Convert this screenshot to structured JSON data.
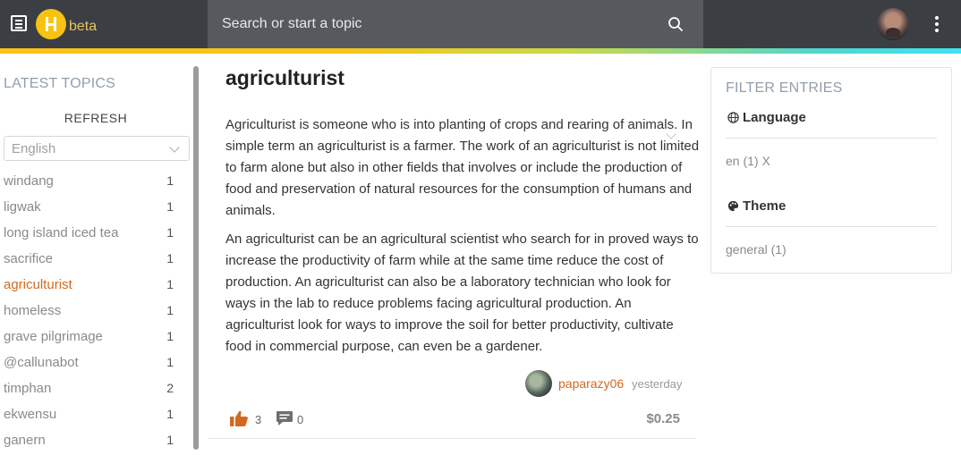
{
  "header": {
    "beta_label": "beta",
    "search_placeholder": "Search or start a topic"
  },
  "sidebar": {
    "heading": "LATEST TOPICS",
    "refresh_label": "REFRESH",
    "language_selected": "English",
    "topics": [
      {
        "name": "windang",
        "count": "1"
      },
      {
        "name": "ligwak",
        "count": "1"
      },
      {
        "name": "long island iced tea",
        "count": "1"
      },
      {
        "name": "sacrifice",
        "count": "1"
      },
      {
        "name": "agriculturist",
        "count": "1"
      },
      {
        "name": "homeless",
        "count": "1"
      },
      {
        "name": "grave pilgrimage",
        "count": "1"
      },
      {
        "name": "@callunabot",
        "count": "1"
      },
      {
        "name": "timphan",
        "count": "2"
      },
      {
        "name": "ekwensu",
        "count": "1"
      },
      {
        "name": "ganern",
        "count": "1"
      }
    ]
  },
  "article": {
    "title": "agriculturist",
    "paragraphs": [
      "Agriculturist is someone who is into planting of crops and rearing of animals. In simple term an agriculturist is a farmer. The work of an agriculturist is not limited to farm alone but also in other fields that involves or include the production of food and preservation of natural resources for the consumption of humans and animals.",
      "An agriculturist can be an agricultural scientist who search for in proved ways to increase the productivity of farm while at the same time reduce the cost of production. An agriculturist can also be a laboratory technician who look for ways in the lab to reduce problems facing agricultural production. An agriculturist look for ways to improve the soil for better productivity, cultivate food in commercial purpose, can even be a gardener."
    ],
    "author": "paparazy06",
    "time": "yesterday",
    "likes": "3",
    "comments": "0",
    "payout": "$0.25"
  },
  "filters": {
    "heading": "FILTER ENTRIES",
    "language_label": "Language",
    "language_value": "en (1) X",
    "theme_label": "Theme",
    "theme_value": "general (1)"
  },
  "colors": {
    "topbar": "#3b3f44",
    "accent_orange": "#d2691e",
    "logo_yellow": "#f6c313",
    "stripe_start": "#f9c316",
    "stripe_end": "#3fe3ef"
  },
  "icons": [
    "list-menu-icon",
    "hive-logo-icon",
    "search-icon",
    "kebab-menu-icon",
    "chevron-down-icon",
    "thumbs-up-icon",
    "comment-icon",
    "globe-icon",
    "palette-icon"
  ]
}
